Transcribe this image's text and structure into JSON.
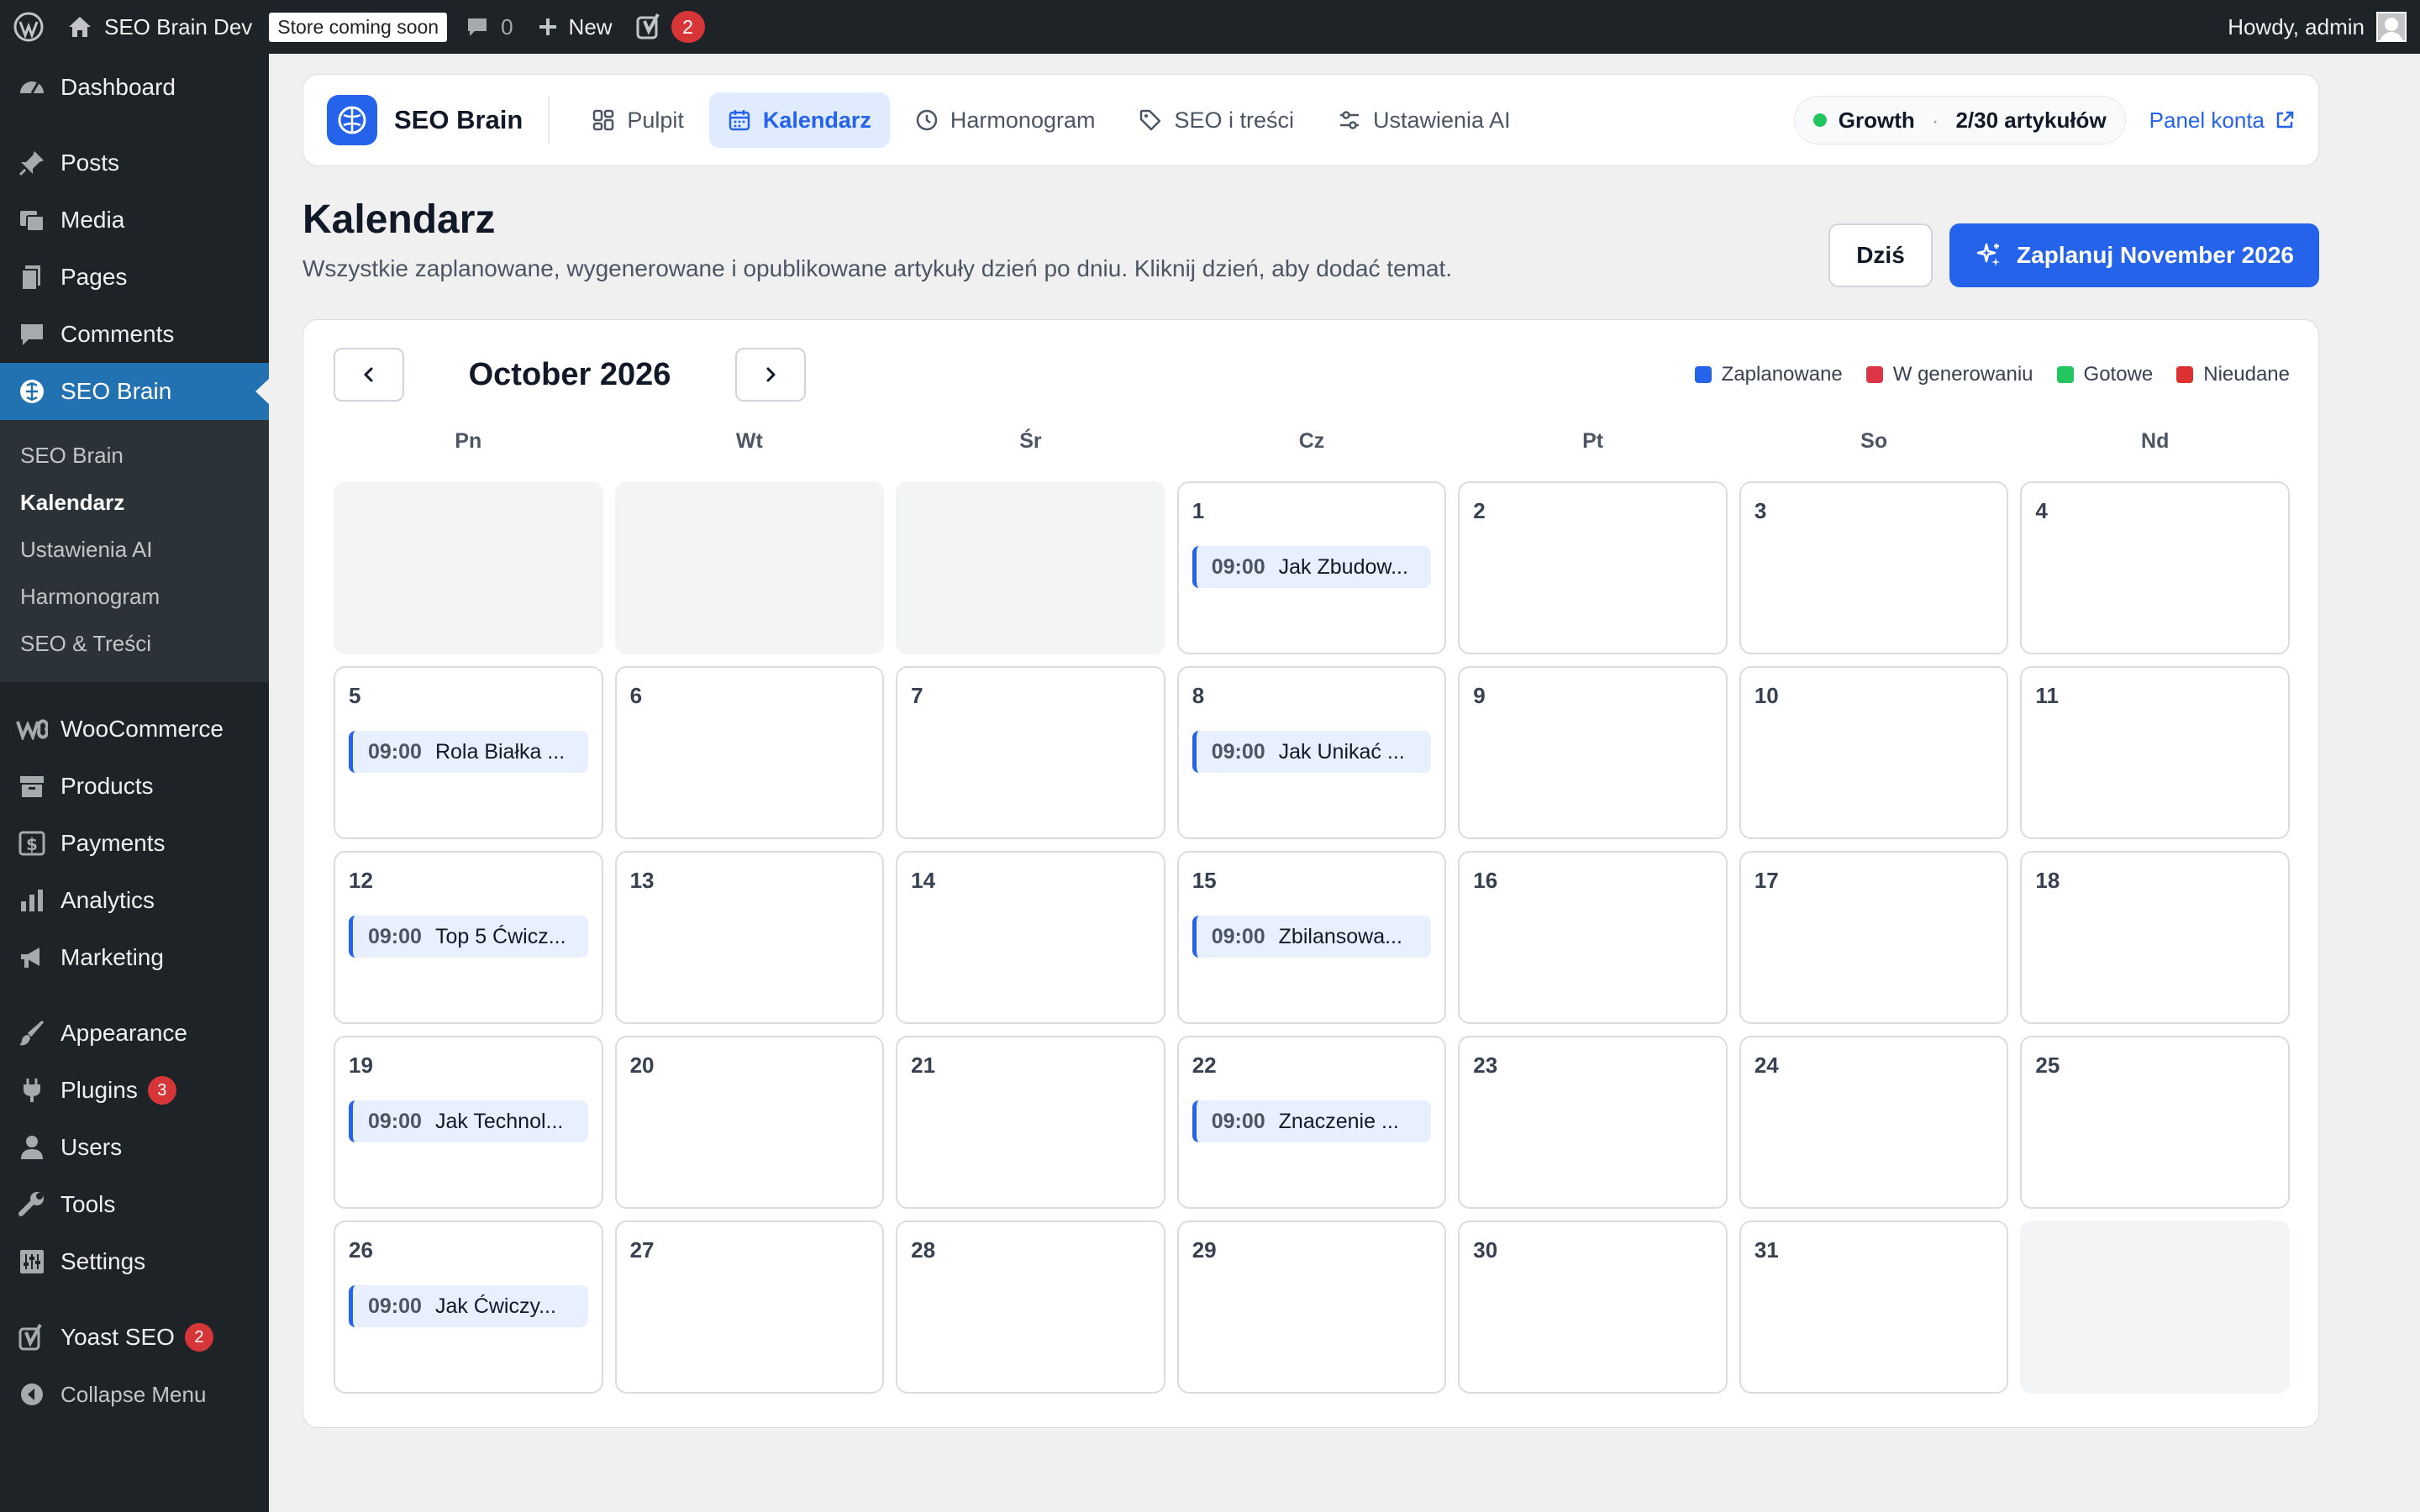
{
  "adminbar": {
    "site_name": "SEO Brain Dev",
    "store_badge": "Store coming soon",
    "comments_count": "0",
    "new_label": "New",
    "yoast_badge": "2",
    "greeting": "Howdy, admin"
  },
  "sidebar": {
    "items": [
      {
        "label": "Dashboard"
      },
      {
        "label": "Posts"
      },
      {
        "label": "Media"
      },
      {
        "label": "Pages"
      },
      {
        "label": "Comments"
      },
      {
        "label": "SEO Brain"
      },
      {
        "label": "WooCommerce"
      },
      {
        "label": "Products"
      },
      {
        "label": "Payments"
      },
      {
        "label": "Analytics"
      },
      {
        "label": "Marketing"
      },
      {
        "label": "Appearance"
      },
      {
        "label": "Plugins",
        "badge": "3"
      },
      {
        "label": "Users"
      },
      {
        "label": "Tools"
      },
      {
        "label": "Settings"
      },
      {
        "label": "Yoast SEO",
        "badge": "2"
      },
      {
        "label": "Collapse Menu"
      }
    ],
    "submenu": [
      "SEO Brain",
      "Kalendarz",
      "Ustawienia AI",
      "Harmonogram",
      "SEO & Treści"
    ]
  },
  "topnav": {
    "brand": "SEO Brain",
    "tabs": [
      {
        "label": "Pulpit"
      },
      {
        "label": "Kalendarz"
      },
      {
        "label": "Harmonogram"
      },
      {
        "label": "SEO i treści"
      },
      {
        "label": "Ustawienia AI"
      }
    ],
    "plan_name": "Growth",
    "plan_sep": "·",
    "plan_usage": "2/30 artykułów",
    "account_link": "Panel konta"
  },
  "page": {
    "title": "Kalendarz",
    "subtitle": "Wszystkie zaplanowane, wygenerowane i opublikowane artykuły dzień po dniu. Kliknij dzień, aby dodać temat.",
    "today_button": "Dziś",
    "plan_button": "Zaplanuj November 2026"
  },
  "calendar": {
    "month_title": "October 2026",
    "legend": [
      {
        "label": "Zaplanowane",
        "color": "#2563eb"
      },
      {
        "label": "W generowaniu",
        "color": "#dc3545"
      },
      {
        "label": "Gotowe",
        "color": "#22c55e"
      },
      {
        "label": "Nieudane",
        "color": "#dc3232"
      }
    ],
    "weekdays": [
      "Pn",
      "Wt",
      "Śr",
      "Cz",
      "Pt",
      "So",
      "Nd"
    ],
    "leading_empty": 3,
    "days_in_month": 31,
    "events": {
      "1": [
        {
          "time": "09:00",
          "title": "Jak Zbudow..."
        }
      ],
      "5": [
        {
          "time": "09:00",
          "title": "Rola Białka ..."
        }
      ],
      "8": [
        {
          "time": "09:00",
          "title": "Jak Unikać ..."
        }
      ],
      "12": [
        {
          "time": "09:00",
          "title": "Top 5 Ćwicz..."
        }
      ],
      "15": [
        {
          "time": "09:00",
          "title": "Zbilansowa..."
        }
      ],
      "19": [
        {
          "time": "09:00",
          "title": "Jak Technol..."
        }
      ],
      "22": [
        {
          "time": "09:00",
          "title": "Znaczenie ..."
        }
      ],
      "26": [
        {
          "time": "09:00",
          "title": "Jak Ćwiczy..."
        }
      ]
    }
  }
}
